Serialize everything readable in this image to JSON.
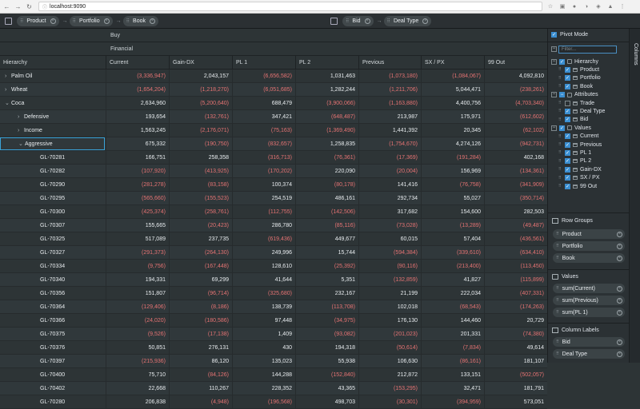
{
  "browser": {
    "url": "localhost:9090"
  },
  "toolbar": {
    "row_chips": [
      "Product",
      "Portfolio",
      "Book"
    ],
    "col_chips": [
      "Bid",
      "Deal Type"
    ]
  },
  "grid": {
    "header_top": "Buy",
    "header_mid": "Financial",
    "columns": [
      "Hierarchy",
      "Current",
      "Gain-DX",
      "PL 1",
      "PL 2",
      "Previous",
      "SX / PX",
      "99 Out"
    ],
    "rows": [
      {
        "label": "Palm Oil",
        "level": 0,
        "expander": "›",
        "values": [
          "(3,336,947)",
          "2,043,157",
          "(6,656,582)",
          "1,031,463",
          "(1,073,180)",
          "(1,084,067)",
          "4,092,810"
        ]
      },
      {
        "label": "Wheat",
        "level": 0,
        "expander": "›",
        "values": [
          "(1,654,204)",
          "(1,218,270)",
          "(6,051,685)",
          "1,282,244",
          "(1,211,706)",
          "5,044,471",
          "(238,261)"
        ]
      },
      {
        "label": "Coca",
        "level": 0,
        "expander": "⌄",
        "values": [
          "2,634,960",
          "(5,200,640)",
          "688,479",
          "(3,900,066)",
          "(1,163,880)",
          "4,400,756",
          "(4,703,340)"
        ]
      },
      {
        "label": "Defensive",
        "level": 1,
        "expander": "›",
        "values": [
          "193,654",
          "(132,761)",
          "347,421",
          "(648,487)",
          "213,987",
          "175,971",
          "(612,602)"
        ]
      },
      {
        "label": "Income",
        "level": 1,
        "expander": "›",
        "values": [
          "1,563,245",
          "(2,176,071)",
          "(75,163)",
          "(1,369,490)",
          "1,441,392",
          "20,345",
          "(62,102)"
        ]
      },
      {
        "label": "Aggressive",
        "level": 1,
        "expander": "⌄",
        "values": [
          "675,332",
          "(190,750)",
          "(832,657)",
          "1,258,835",
          "(1,754,670)",
          "4,274,126",
          "(942,731)"
        ]
      },
      {
        "label": "GL-70281",
        "level": 2,
        "expander": "",
        "values": [
          "166,751",
          "258,358",
          "(316,713)",
          "(76,361)",
          "(17,369)",
          "(191,284)",
          "402,168"
        ]
      },
      {
        "label": "GL-70282",
        "level": 2,
        "expander": "",
        "values": [
          "(107,920)",
          "(413,925)",
          "(170,202)",
          "220,090",
          "(20,004)",
          "156,969",
          "(134,361)"
        ]
      },
      {
        "label": "GL-70290",
        "level": 2,
        "expander": "",
        "values": [
          "(281,278)",
          "(83,158)",
          "100,374",
          "(80,178)",
          "141,416",
          "(76,758)",
          "(341,909)"
        ]
      },
      {
        "label": "GL-70295",
        "level": 2,
        "expander": "",
        "values": [
          "(565,660)",
          "(155,523)",
          "254,519",
          "486,161",
          "292,734",
          "55,027",
          "(350,714)"
        ]
      },
      {
        "label": "GL-70300",
        "level": 2,
        "expander": "",
        "values": [
          "(425,374)",
          "(258,761)",
          "(112,755)",
          "(142,506)",
          "317,682",
          "154,600",
          "282,503"
        ]
      },
      {
        "label": "GL-70307",
        "level": 2,
        "expander": "",
        "values": [
          "155,665",
          "(20,423)",
          "286,780",
          "(85,116)",
          "(73,028)",
          "(13,289)",
          "(49,487)"
        ]
      },
      {
        "label": "GL-70325",
        "level": 2,
        "expander": "",
        "values": [
          "517,089",
          "237,735",
          "(619,436)",
          "449,677",
          "60,015",
          "57,404",
          "(436,561)"
        ]
      },
      {
        "label": "GL-70327",
        "level": 2,
        "expander": "",
        "values": [
          "(291,373)",
          "(264,130)",
          "249,996",
          "15,744",
          "(594,384)",
          "(339,610)",
          "(634,410)"
        ]
      },
      {
        "label": "GL-70334",
        "level": 2,
        "expander": "",
        "values": [
          "(9,756)",
          "(167,448)",
          "128,610",
          "(25,392)",
          "(90,116)",
          "(213,400)",
          "(113,450)"
        ]
      },
      {
        "label": "GL-70340",
        "level": 2,
        "expander": "",
        "values": [
          "194,331",
          "69,299",
          "41,644",
          "5,351",
          "(132,859)",
          "41,827",
          "(115,899)"
        ]
      },
      {
        "label": "GL-70356",
        "level": 2,
        "expander": "",
        "values": [
          "151,807",
          "(96,714)",
          "(325,680)",
          "232,167",
          "21,199",
          "222,034",
          "(407,331)"
        ]
      },
      {
        "label": "GL-70364",
        "level": 2,
        "expander": "",
        "values": [
          "(129,406)",
          "(8,186)",
          "138,739",
          "(113,708)",
          "102,018",
          "(68,543)",
          "(174,263)"
        ]
      },
      {
        "label": "GL-70366",
        "level": 2,
        "expander": "",
        "values": [
          "(24,020)",
          "(180,586)",
          "97,448",
          "(34,975)",
          "176,130",
          "144,460",
          "20,729"
        ]
      },
      {
        "label": "GL-70375",
        "level": 2,
        "expander": "",
        "values": [
          "(9,526)",
          "(17,138)",
          "1,409",
          "(93,082)",
          "(201,023)",
          "201,331",
          "(74,380)"
        ]
      },
      {
        "label": "GL-70376",
        "level": 2,
        "expander": "",
        "values": [
          "50,851",
          "276,131",
          "430",
          "194,318",
          "(50,614)",
          "(7,834)",
          "49,614"
        ]
      },
      {
        "label": "GL-70397",
        "level": 2,
        "expander": "",
        "values": [
          "(215,936)",
          "86,120",
          "135,023",
          "55,938",
          "106,630",
          "(86,161)",
          "181,107"
        ]
      },
      {
        "label": "GL-70400",
        "level": 2,
        "expander": "",
        "values": [
          "75,710",
          "(84,126)",
          "144,288",
          "(152,840)",
          "212,872",
          "133,151",
          "(502,057)"
        ]
      },
      {
        "label": "GL-70402",
        "level": 2,
        "expander": "",
        "values": [
          "22,668",
          "110,267",
          "228,352",
          "43,365",
          "(153,295)",
          "32,471",
          "181,791"
        ]
      },
      {
        "label": "GL-70280",
        "level": 2,
        "expander": "",
        "values": [
          "206,838",
          "(4,948)",
          "(196,568)",
          "498,703",
          "(30,301)",
          "(394,959)",
          "573,051"
        ]
      }
    ]
  },
  "sidebar": {
    "pivot_mode_label": "Pivot Mode",
    "filter_placeholder": "Filter...",
    "tree": [
      {
        "label": "Hierarchy",
        "level": 0,
        "toggle": "−",
        "check": "on",
        "icon": "folder"
      },
      {
        "label": "Product",
        "level": 1,
        "toggle": "",
        "check": "on",
        "icon": "column"
      },
      {
        "label": "Portfolio",
        "level": 1,
        "toggle": "",
        "check": "on",
        "icon": "column"
      },
      {
        "label": "Book",
        "level": 1,
        "toggle": "",
        "check": "on",
        "icon": "column"
      },
      {
        "label": "Attributes",
        "level": 0,
        "toggle": "−",
        "check": "part",
        "icon": "folder"
      },
      {
        "label": "Trade",
        "level": 1,
        "toggle": "",
        "check": "off",
        "icon": "column"
      },
      {
        "label": "Deal Type",
        "level": 1,
        "toggle": "",
        "check": "on",
        "icon": "column"
      },
      {
        "label": "Bid",
        "level": 1,
        "toggle": "",
        "check": "on",
        "icon": "column"
      },
      {
        "label": "Values",
        "level": 0,
        "toggle": "−",
        "check": "on",
        "icon": "folder"
      },
      {
        "label": "Current",
        "level": 1,
        "toggle": "",
        "check": "on",
        "icon": "column"
      },
      {
        "label": "Previous",
        "level": 1,
        "toggle": "",
        "check": "on",
        "icon": "column"
      },
      {
        "label": "PL 1",
        "level": 1,
        "toggle": "",
        "check": "on",
        "icon": "column"
      },
      {
        "label": "PL 2",
        "level": 1,
        "toggle": "",
        "check": "on",
        "icon": "column"
      },
      {
        "label": "Gain-DX",
        "level": 1,
        "toggle": "",
        "check": "on",
        "icon": "column"
      },
      {
        "label": "SX / PX",
        "level": 1,
        "toggle": "",
        "check": "on",
        "icon": "column"
      },
      {
        "label": "99 Out",
        "level": 1,
        "toggle": "",
        "check": "on",
        "icon": "column"
      }
    ],
    "row_groups_title": "Row Groups",
    "row_groups": [
      "Product",
      "Portfolio",
      "Book"
    ],
    "values_title": "Values",
    "values": [
      "sum(Current)",
      "sum(Previous)",
      "sum(PL 1)"
    ],
    "column_labels_title": "Column Labels",
    "column_labels": [
      "Bid",
      "Deal Type"
    ],
    "side_tab_label": "Columns"
  }
}
